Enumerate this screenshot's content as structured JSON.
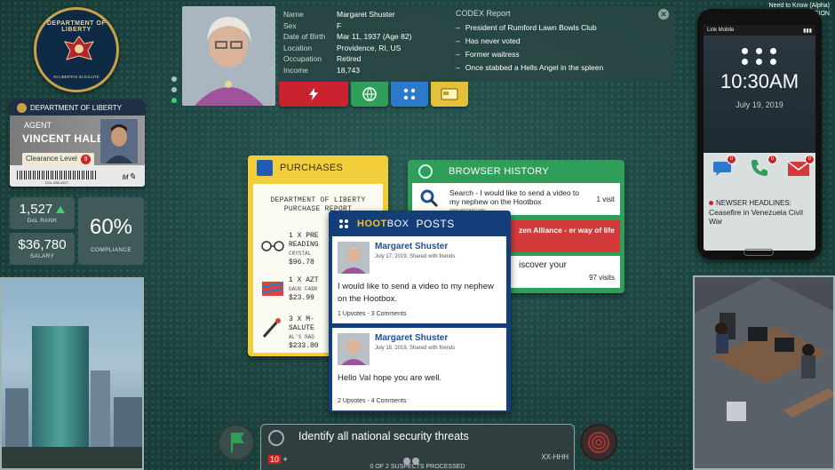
{
  "seal": {
    "top_text": "DEPARTMENT OF LIBERTY",
    "bottom_text": "IN LIBERTAS IN SALUTE"
  },
  "agent_card": {
    "header": "DEPARTMENT OF LIBERTY",
    "role": "AGENT",
    "name": "VINCENT HALE",
    "clearance_label": "Clearance Level",
    "clearance_level": "9",
    "serial": "DOL 836 4327"
  },
  "stats": {
    "rank_value": "1,527",
    "rank_label": "DoL RANK",
    "salary_value": "$36,780",
    "salary_label": "SALARY",
    "compliance_value": "60%",
    "compliance_label": "COMPLIANCE"
  },
  "profile": {
    "fields": [
      {
        "key": "Name",
        "value": "Margaret Shuster"
      },
      {
        "key": "Sex",
        "value": "F"
      },
      {
        "key": "Date of Birth",
        "value": "Mar 11, 1937 (Age 82)"
      },
      {
        "key": "Location",
        "value": "Providence, RI, US"
      },
      {
        "key": "Occupation",
        "value": "Retired"
      },
      {
        "key": "Income",
        "value": "18,743"
      }
    ]
  },
  "codex": {
    "title": "CODEX Report",
    "items": [
      "President of Rumford Lawn Bowls Club",
      "Has never voted",
      "Former waitress",
      "Once stabbed a Hells Angel in the spleen"
    ],
    "close_label": "✕"
  },
  "tabs": {
    "alert_icon": "lightning-icon",
    "web_icon": "globe-icon",
    "social_icon": "hootbox-icon",
    "card_icon": "credit-card-icon"
  },
  "dev_note": {
    "line1": "Need to Know (Alpha)",
    "line2": "DEVELOPMENT VERSION"
  },
  "phone": {
    "carrier": "Link Mobile",
    "time": "10:30AM",
    "date": "July 19, 2019",
    "badges": [
      "0",
      "0",
      "0"
    ],
    "news_header": "NEWSER HEADLINES:",
    "news_text": "Ceasefire in Venezuela Civil War"
  },
  "purchases": {
    "title": "PURCHASES",
    "receipt_title_1": "DEPARTMENT OF LIBERTY",
    "receipt_title_2": "PURCHASE REPORT",
    "items": [
      {
        "line1": "1 X PRE",
        "line2": "READING",
        "line3": "CRYSTAL",
        "price": "$96.78"
      },
      {
        "line1": "1 X AZT",
        "line2": "GAUG FABR",
        "line3": "",
        "price": "$23.99"
      },
      {
        "line1": "3 X M-",
        "line2": "SALUTE",
        "line3": "AL'S RAD",
        "price": "$233.80"
      }
    ]
  },
  "browser": {
    "title": "BROWSER HISTORY",
    "entries": [
      {
        "text": "Search - I would like to send a video to my nephew on the Hootbox",
        "url": "www.wizzard.com",
        "visits": "1 visit"
      },
      {
        "text": "zen Alliance - er way of life",
        "url": "",
        "visits": ""
      },
      {
        "text": "iscover your",
        "url": "",
        "visits": "97 visits"
      }
    ]
  },
  "hootbox": {
    "logo_a": "HOOT",
    "logo_b": "BOX",
    "section": "POSTS",
    "posts": [
      {
        "name": "Margaret Shuster",
        "date": "July 17, 2019, Shared with friends",
        "body": "I would like to send a video to my nephew on the Hootbox.",
        "meta": "1 Upvotes - 3 Comments"
      },
      {
        "name": "Margaret Shuster",
        "date": "July 18, 2019, Shared with friends",
        "body": "Hello Val hope you are well.",
        "meta": "2 Upvotes - 4 Comments"
      }
    ]
  },
  "objective": {
    "text": "Identify all national security threats",
    "count": "10",
    "count_suffix": "+",
    "suspects": "0 OF 2 SUSPECTS PROCESSED",
    "code": "XX-HHH"
  },
  "colors": {
    "background": "#1d4440",
    "alert_red": "#c9232f",
    "browser_green": "#2f9e58",
    "hootbox_blue": "#143e7a",
    "purchases_yellow": "#f2cf3a"
  }
}
